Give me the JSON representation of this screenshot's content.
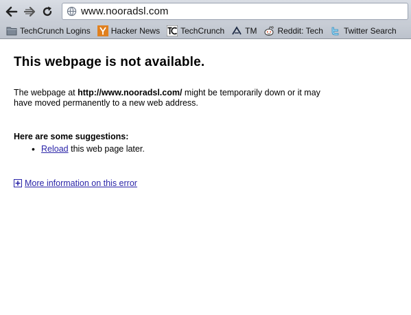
{
  "toolbar": {
    "back_icon": "back-arrow-icon",
    "forward_icon": "forward-arrow-icon",
    "reload_icon": "reload-icon",
    "url": "www.nooradsl.com",
    "page_icon": "globe-icon"
  },
  "bookmarks": [
    {
      "label": "TechCrunch Logins",
      "icon": "folder-icon"
    },
    {
      "label": "Hacker News",
      "icon": "y-combinator-icon"
    },
    {
      "label": "TechCrunch",
      "icon": "techcrunch-icon"
    },
    {
      "label": "TM",
      "icon": "tm-icon"
    },
    {
      "label": "Reddit: Tech",
      "icon": "reddit-icon"
    },
    {
      "label": "Twitter Search",
      "icon": "twitter-icon"
    }
  ],
  "error": {
    "title": "This webpage is not available.",
    "desc_prefix": "The webpage at ",
    "desc_url": "http://www.nooradsl.com/",
    "desc_suffix": " might be temporarily down or it may have moved permanently to a new web address.",
    "suggestions_heading": "Here are some suggestions:",
    "suggestion_link": "Reload",
    "suggestion_text": " this web page later.",
    "more_info": "More information on this error"
  },
  "colors": {
    "link": "#2a24a8",
    "toolbar": "#d0d4dc"
  }
}
